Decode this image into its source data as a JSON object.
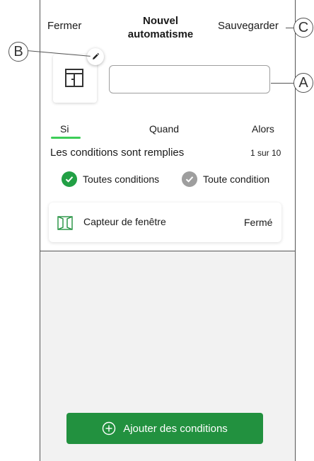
{
  "header": {
    "close_label": "Fermer",
    "title": "Nouvel automatisme",
    "save_label": "Sauvegarder"
  },
  "name_input": {
    "value": "",
    "placeholder": ""
  },
  "tabs": [
    {
      "label": "Si",
      "active": true
    },
    {
      "label": "Quand",
      "active": false
    },
    {
      "label": "Alors",
      "active": false
    }
  ],
  "conditions": {
    "label": "Les conditions sont remplies",
    "count": "1 sur 10",
    "options": [
      {
        "label": "Toutes conditions",
        "selected": true
      },
      {
        "label": "Toute condition",
        "selected": false
      }
    ]
  },
  "sensor": {
    "name": "Capteur de fenêtre",
    "state": "Fermé",
    "icon": "window-sensor-icon"
  },
  "add_button": {
    "label": "Ajouter des conditions",
    "icon": "plus-circle-icon"
  },
  "callouts": {
    "a": "A",
    "b": "B",
    "c": "C"
  },
  "colors": {
    "accent": "#3dcd58",
    "button": "#22913f",
    "check_inactive": "#9e9e9e"
  }
}
